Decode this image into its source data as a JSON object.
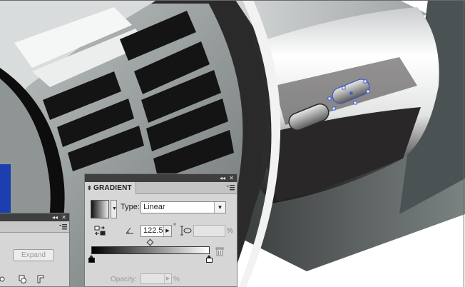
{
  "gradient_panel": {
    "tab_label": "GRADIENT",
    "type_label": "Type:",
    "type_value": "Linear",
    "angle_value": "122.5",
    "degree_symbol": "°",
    "aspect_percent": "%",
    "opacity_label": "Opacity:",
    "opacity_percent": "%",
    "collapse_glyph": "◂◂",
    "close_glyph": "✕",
    "gradient_start_color": "#000000",
    "gradient_end_color": "#ffffff"
  },
  "left_panel": {
    "expand_label": "Expand",
    "collapse_glyph": "◂◂",
    "close_glyph": "✕"
  },
  "icons": [
    "reverse-gradient-icon",
    "angle-icon",
    "aspect-ratio-icon",
    "delete-stop-icon",
    "panel-menu-icon",
    "chevron-down-icon"
  ]
}
